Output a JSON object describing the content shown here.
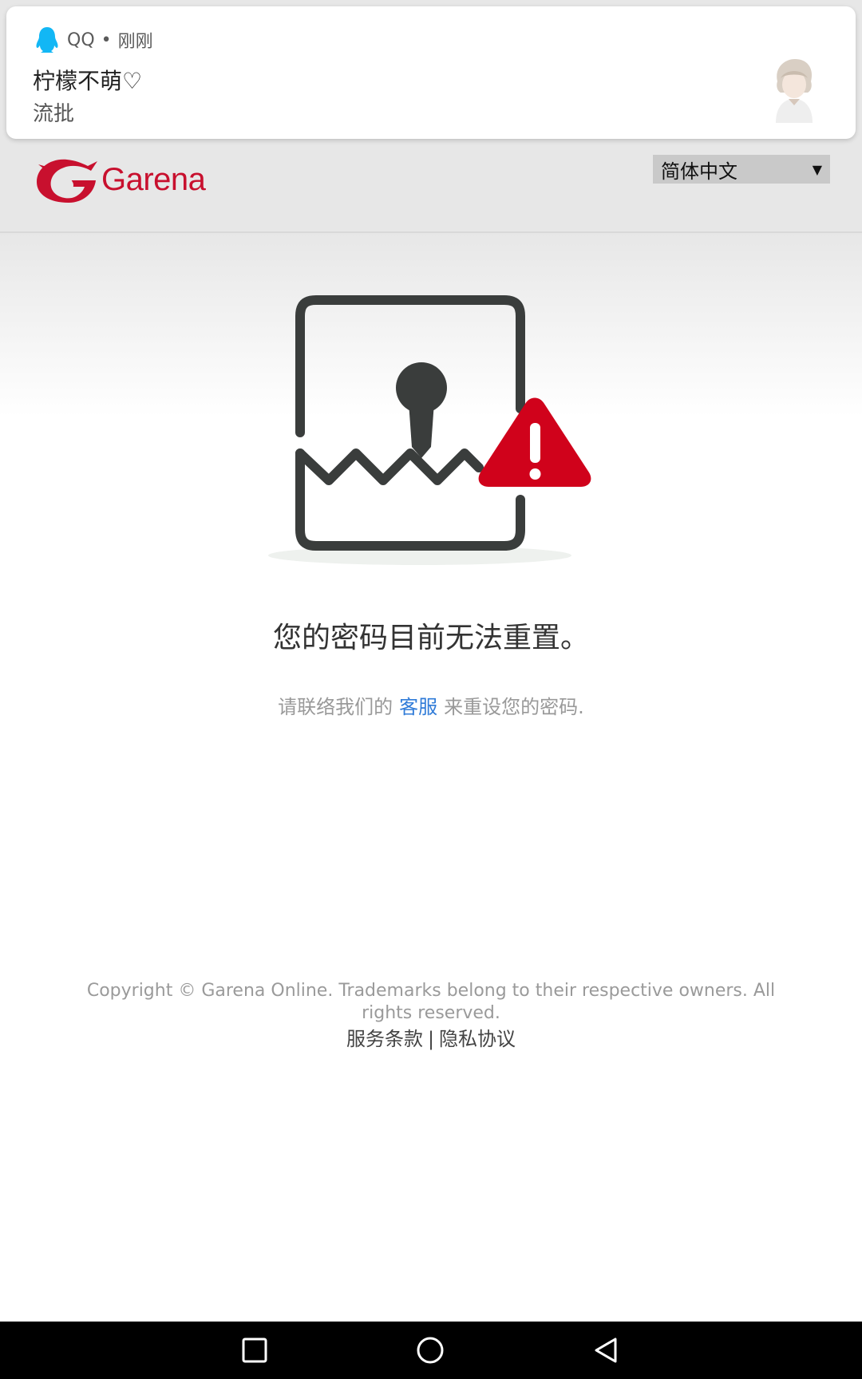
{
  "notification": {
    "app_name": "QQ",
    "separator": "•",
    "time": "刚刚",
    "title": "柠檬不萌♡",
    "message": "流批"
  },
  "header": {
    "logo_text": "Garena",
    "language": "简体中文"
  },
  "main": {
    "title": "您的密码目前无法重置。",
    "body_prefix": "请联络我们的",
    "body_link": "客服",
    "body_suffix": "来重设您的密码."
  },
  "footer": {
    "copyright": "Copyright © Garena Online. Trademarks belong to their respective owners. All rights reserved.",
    "terms": "服务条款",
    "separator": "|",
    "privacy": "隐私协议"
  },
  "colors": {
    "brand_red": "#c8102e",
    "link_blue": "#2f7bd8",
    "header_gray": "#e7e7e7"
  },
  "icons": {
    "qq": "qq-penguin-icon",
    "caret": "chevron-down-icon",
    "recent": "square-icon",
    "home": "circle-icon",
    "back": "triangle-back-icon"
  }
}
